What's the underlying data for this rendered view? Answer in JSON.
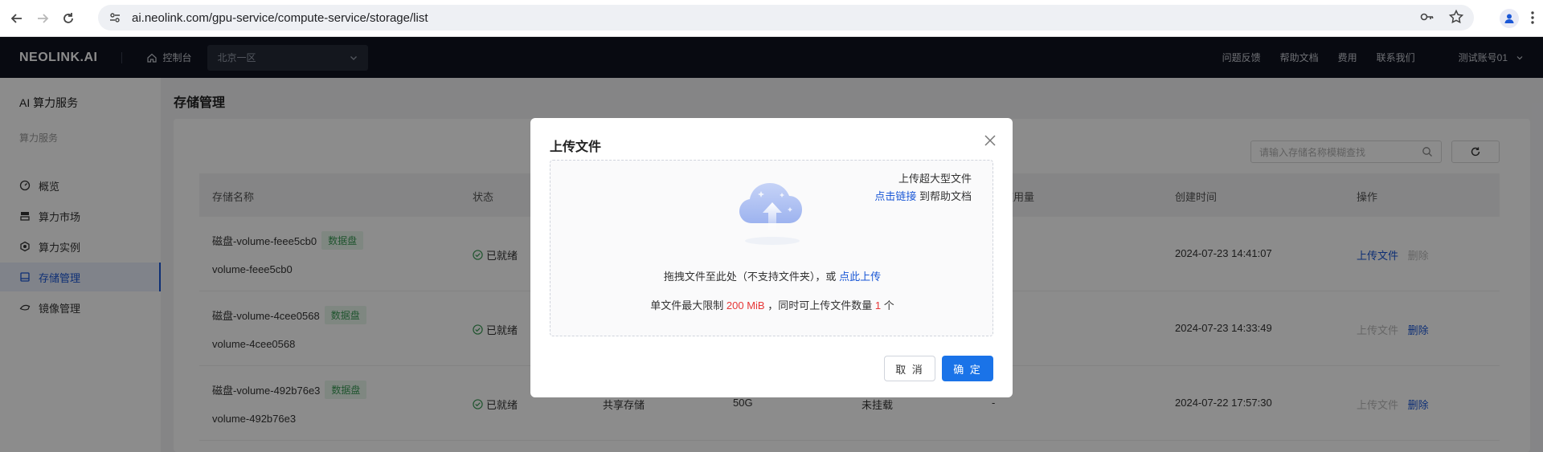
{
  "browser": {
    "url": "ai.neolink.com/gpu-service/compute-service/storage/list"
  },
  "header": {
    "logo": "NEOLINK.AI",
    "console_label": "控制台",
    "region": "北京一区",
    "links": [
      "问题反馈",
      "帮助文档",
      "费用",
      "联系我们"
    ],
    "user": "测试账号01"
  },
  "sidebar": {
    "title": "AI 算力服务",
    "section": "算力服务",
    "items": [
      {
        "label": "概览",
        "icon": "dashboard-icon"
      },
      {
        "label": "算力市场",
        "icon": "market-icon"
      },
      {
        "label": "算力实例",
        "icon": "instance-icon"
      },
      {
        "label": "存储管理",
        "icon": "storage-icon"
      },
      {
        "label": "镜像管理",
        "icon": "image-icon"
      }
    ]
  },
  "main": {
    "page_title": "存储管理",
    "search_placeholder": "请输入存储名称模糊查找",
    "columns": [
      "存储名称",
      "状态",
      "使用量",
      "创建时间",
      "操作"
    ],
    "rows": [
      {
        "name": "磁盘-volume-feee5cb0",
        "badge": "数据盘",
        "id": "volume-feee5cb0",
        "status": "已就绪",
        "type": "",
        "size": "",
        "mount": "",
        "usage": "",
        "created": "2024-07-23 14:41:07",
        "action1": "上传文件",
        "action2": "删除"
      },
      {
        "name": "磁盘-volume-4cee0568",
        "badge": "数据盘",
        "id": "volume-4cee0568",
        "status": "已就绪",
        "type": "",
        "size": "",
        "mount": "",
        "usage": "",
        "created": "2024-07-23 14:33:49",
        "action1": "上传文件",
        "action2": "删除"
      },
      {
        "name": "磁盘-volume-492b76e3",
        "badge": "数据盘",
        "id": "volume-492b76e3",
        "status": "已就绪",
        "type": "共享存储",
        "size": "50G",
        "mount": "未挂载",
        "usage": "-",
        "created": "2024-07-22 17:57:30",
        "action1": "上传文件",
        "action2": "删除"
      }
    ]
  },
  "modal": {
    "title": "上传文件",
    "big_file_line1": "上传超大型文件",
    "big_file_link": "点击链接",
    "big_file_suffix": "到帮助文档",
    "drop_text": "拖拽文件至此处（不支持文件夹），或",
    "drop_link": "点此上传",
    "limit_prefix": "单文件最大限制",
    "limit_size": "200 MiB",
    "limit_mid": "，同时可上传文件数量",
    "limit_count": "1",
    "limit_suffix": "个",
    "cancel": "取 消",
    "ok": "确 定"
  }
}
